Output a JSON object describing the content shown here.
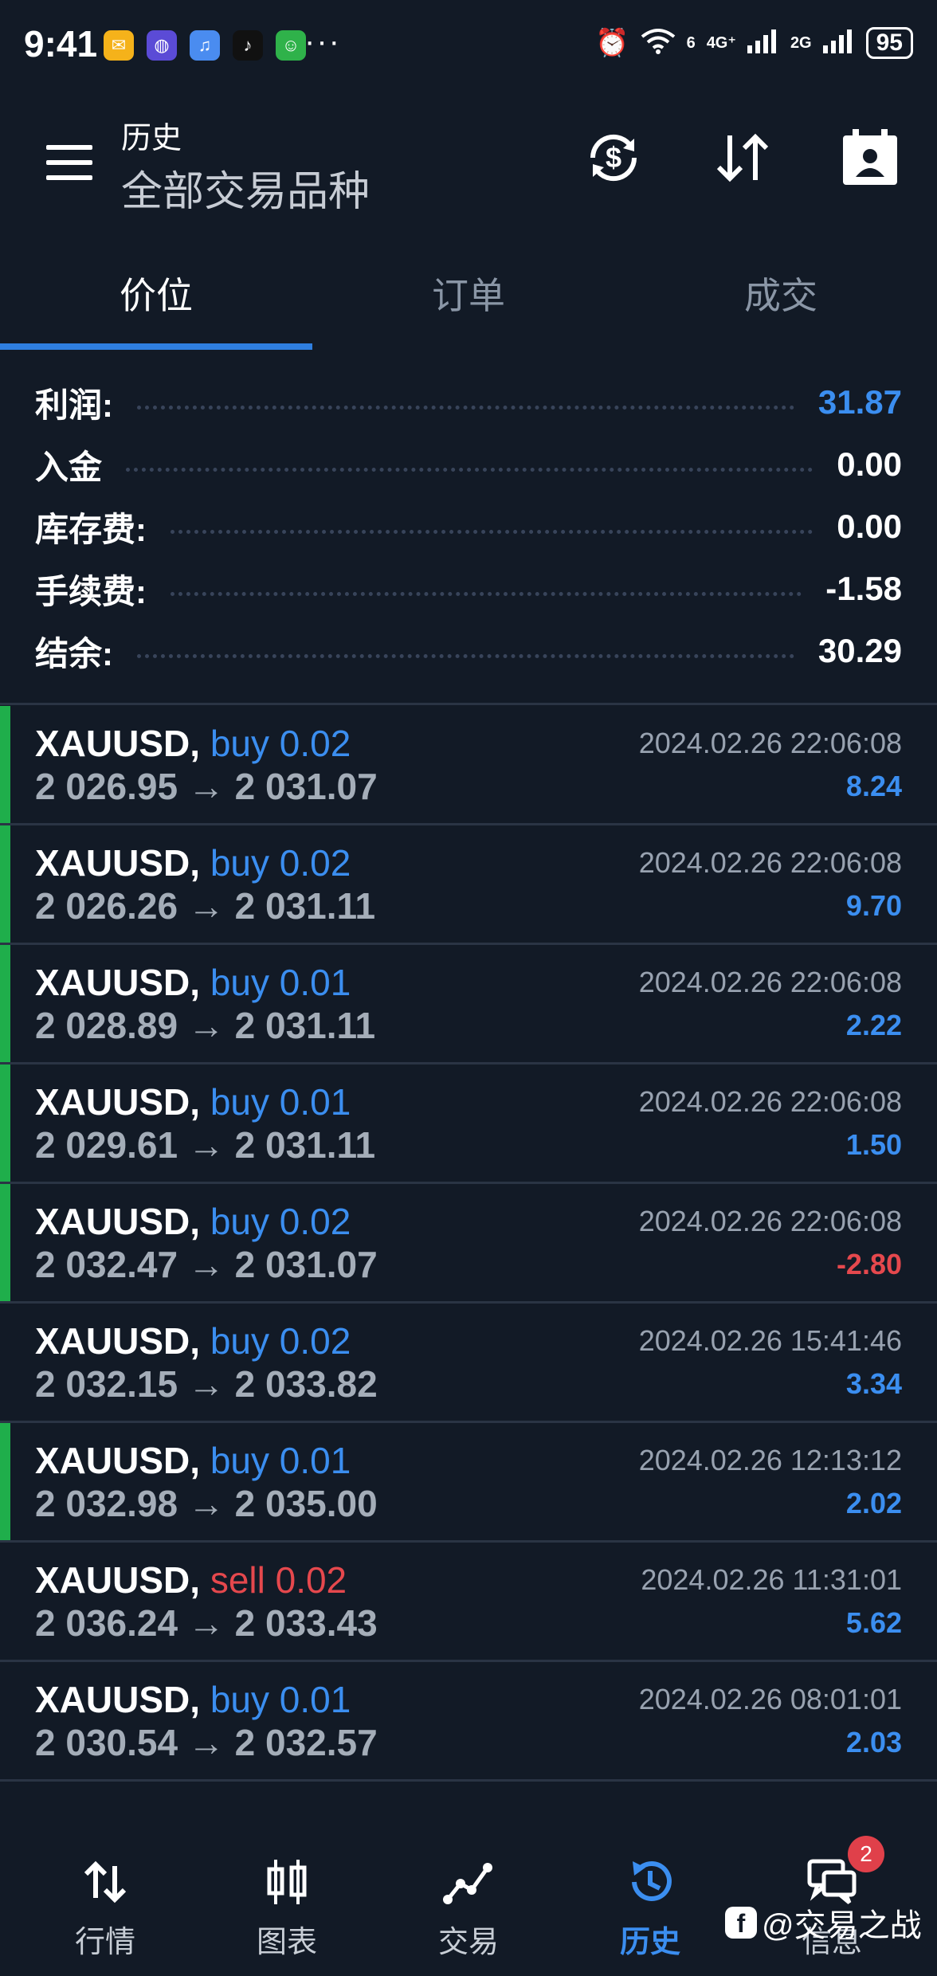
{
  "status_bar": {
    "time": "9:41",
    "net_6": "6",
    "net_4g": "4G⁺",
    "net_2g": "2G",
    "battery": "95"
  },
  "header": {
    "title": "历史",
    "subtitle": "全部交易品种"
  },
  "tabs": [
    {
      "label": "价位",
      "active": true
    },
    {
      "label": "订单",
      "active": false
    },
    {
      "label": "成交",
      "active": false
    }
  ],
  "summary": [
    {
      "label": "利润:",
      "value": "31.87",
      "color": "#3b8ef0"
    },
    {
      "label": "入金",
      "value": "0.00",
      "color": "#ffffff"
    },
    {
      "label": "库存费:",
      "value": "0.00",
      "color": "#ffffff"
    },
    {
      "label": "手续费:",
      "value": "-1.58",
      "color": "#ffffff"
    },
    {
      "label": "结余:",
      "value": "30.29",
      "color": "#ffffff"
    }
  ],
  "trades": [
    {
      "symbol": "XAUUSD,",
      "side": "buy 0.02",
      "side_type": "buy",
      "prices": "2 026.95 → 2 031.07",
      "time": "2024.02.26 22:06:08",
      "profit": "8.24",
      "profit_type": "pos",
      "bar": true
    },
    {
      "symbol": "XAUUSD,",
      "side": "buy 0.02",
      "side_type": "buy",
      "prices": "2 026.26 → 2 031.11",
      "time": "2024.02.26 22:06:08",
      "profit": "9.70",
      "profit_type": "pos",
      "bar": true
    },
    {
      "symbol": "XAUUSD,",
      "side": "buy 0.01",
      "side_type": "buy",
      "prices": "2 028.89 → 2 031.11",
      "time": "2024.02.26 22:06:08",
      "profit": "2.22",
      "profit_type": "pos",
      "bar": true
    },
    {
      "symbol": "XAUUSD,",
      "side": "buy 0.01",
      "side_type": "buy",
      "prices": "2 029.61 → 2 031.11",
      "time": "2024.02.26 22:06:08",
      "profit": "1.50",
      "profit_type": "pos",
      "bar": true
    },
    {
      "symbol": "XAUUSD,",
      "side": "buy 0.02",
      "side_type": "buy",
      "prices": "2 032.47 → 2 031.07",
      "time": "2024.02.26 22:06:08",
      "profit": "-2.80",
      "profit_type": "neg",
      "bar": true
    },
    {
      "symbol": "XAUUSD,",
      "side": "buy 0.02",
      "side_type": "buy",
      "prices": "2 032.15 → 2 033.82",
      "time": "2024.02.26 15:41:46",
      "profit": "3.34",
      "profit_type": "pos",
      "bar": false
    },
    {
      "symbol": "XAUUSD,",
      "side": "buy 0.01",
      "side_type": "buy",
      "prices": "2 032.98 → 2 035.00",
      "time": "2024.02.26 12:13:12",
      "profit": "2.02",
      "profit_type": "pos",
      "bar": true
    },
    {
      "symbol": "XAUUSD,",
      "side": "sell 0.02",
      "side_type": "sell",
      "prices": "2 036.24 → 2 033.43",
      "time": "2024.02.26 11:31:01",
      "profit": "5.62",
      "profit_type": "pos",
      "bar": false
    },
    {
      "symbol": "XAUUSD,",
      "side": "buy 0.01",
      "side_type": "buy",
      "prices": "2 030.54 → 2 032.57",
      "time": "2024.02.26 08:01:01",
      "profit": "2.03",
      "profit_type": "pos",
      "bar": false
    }
  ],
  "bottom_nav": [
    {
      "label": "行情",
      "icon": "arrows-updown-icon",
      "active": false
    },
    {
      "label": "图表",
      "icon": "candlestick-icon",
      "active": false
    },
    {
      "label": "交易",
      "icon": "trend-icon",
      "active": false
    },
    {
      "label": "历史",
      "icon": "history-icon",
      "active": true
    },
    {
      "label": "信息",
      "icon": "chat-icon",
      "active": false
    }
  ],
  "messages_badge": "2",
  "watermark": "@交易之战",
  "colors": {
    "background": "#121a26",
    "accent_blue": "#3b8ef0",
    "loss_red": "#e5484d",
    "row_bar_green": "#1fae4b",
    "tab_underline": "#2f7fe0"
  }
}
